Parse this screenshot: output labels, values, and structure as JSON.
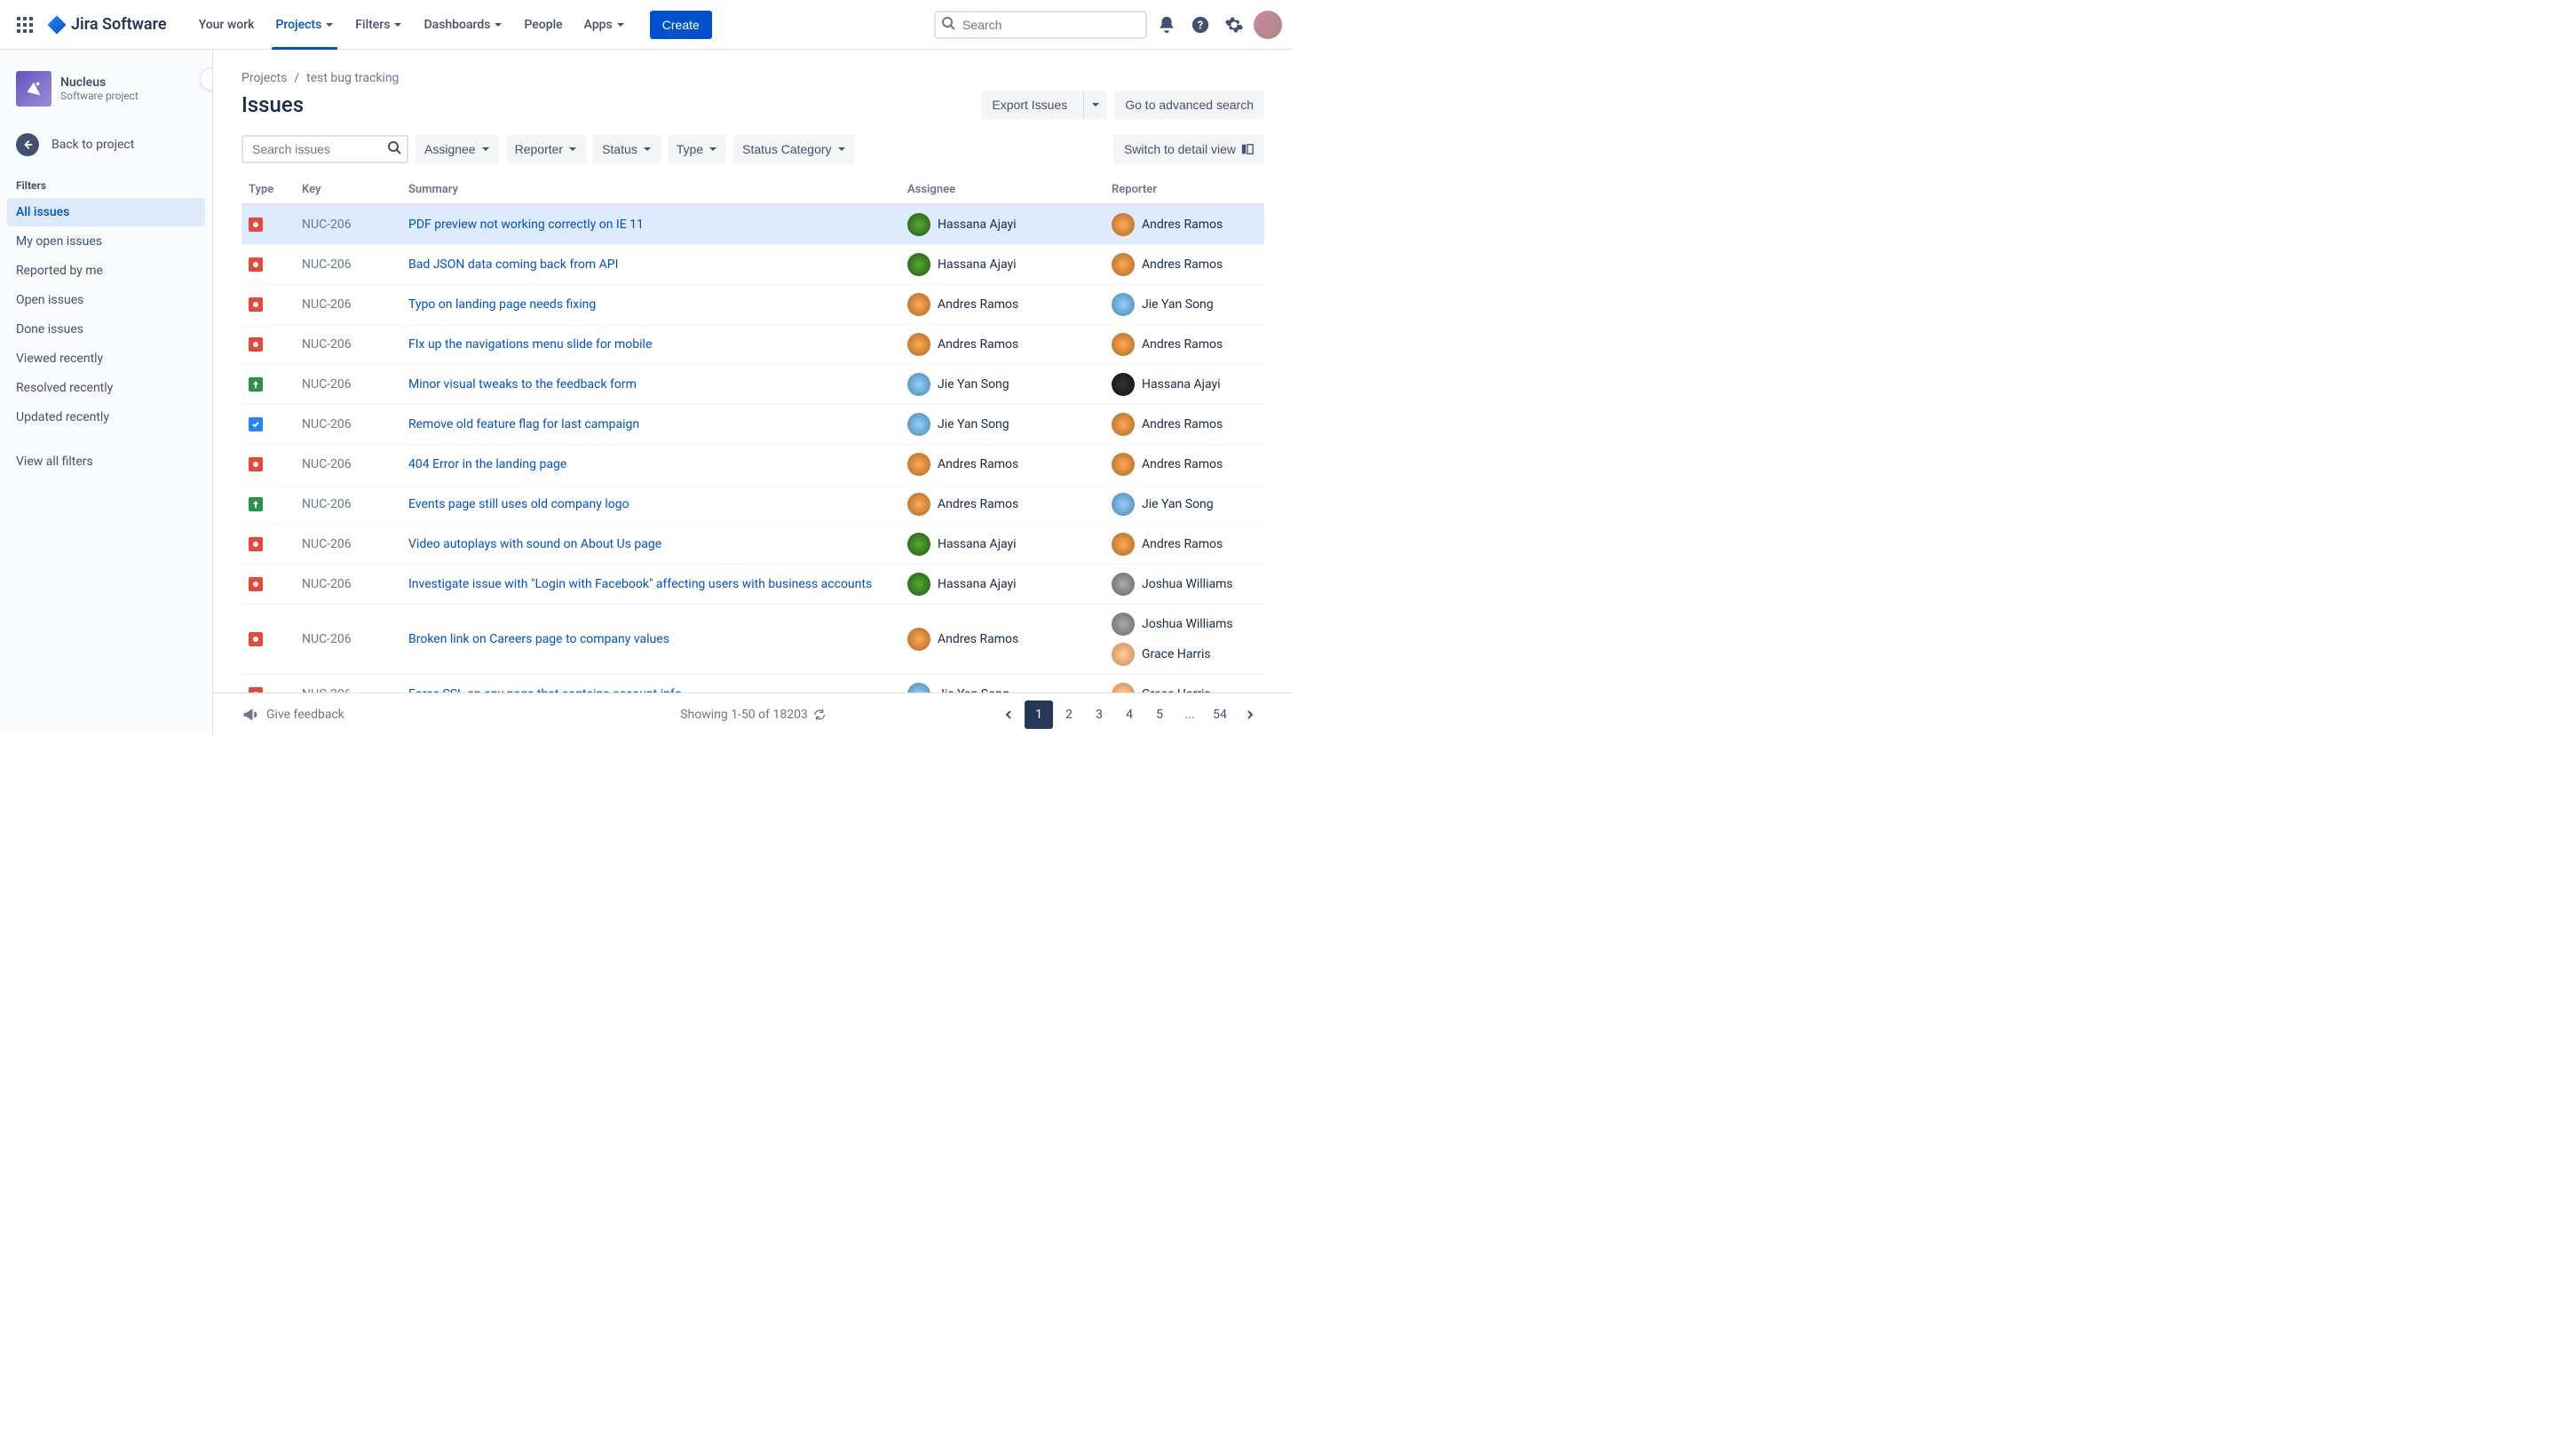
{
  "topnav": {
    "logo_text": "Jira Software",
    "items": [
      {
        "label": "Your work",
        "dropdown": false,
        "active": false
      },
      {
        "label": "Projects",
        "dropdown": true,
        "active": true
      },
      {
        "label": "Filters",
        "dropdown": true,
        "active": false
      },
      {
        "label": "Dashboards",
        "dropdown": true,
        "active": false
      },
      {
        "label": "People",
        "dropdown": false,
        "active": false
      },
      {
        "label": "Apps",
        "dropdown": true,
        "active": false
      }
    ],
    "create_label": "Create",
    "search_placeholder": "Search"
  },
  "sidebar": {
    "project_name": "Nucleus",
    "project_type": "Software project",
    "back_label": "Back to project",
    "filters_heading": "Filters",
    "filters": [
      {
        "label": "All issues",
        "active": true
      },
      {
        "label": "My open issues",
        "active": false
      },
      {
        "label": "Reported by me",
        "active": false
      },
      {
        "label": "Open issues",
        "active": false
      },
      {
        "label": "Done issues",
        "active": false
      },
      {
        "label": "Viewed recently",
        "active": false
      },
      {
        "label": "Resolved recently",
        "active": false
      },
      {
        "label": "Updated recently",
        "active": false
      }
    ],
    "view_all": "View all filters"
  },
  "breadcrumbs": [
    "Projects",
    "test bug tracking"
  ],
  "page_title": "Issues",
  "actions": {
    "export": "Export Issues",
    "advanced": "Go to advanced search"
  },
  "filterbar": {
    "search_placeholder": "Search issues",
    "pills": [
      "Assignee",
      "Reporter",
      "Status",
      "Type",
      "Status Category"
    ],
    "switch_view": "Switch to detail view"
  },
  "columns": [
    "Type",
    "Key",
    "Summary",
    "Assignee",
    "Reporter"
  ],
  "rows": [
    {
      "type": "bug",
      "key": "NUC-206",
      "summary": "PDF preview not working correctly on IE 11",
      "assignee": {
        "name": "Hassana Ajayi",
        "av": "av1"
      },
      "reporter": {
        "name": "Andres Ramos",
        "av": "av2"
      },
      "sel": true
    },
    {
      "type": "bug",
      "key": "NUC-206",
      "summary": "Bad JSON data coming back from API",
      "assignee": {
        "name": "Hassana Ajayi",
        "av": "av1"
      },
      "reporter": {
        "name": "Andres Ramos",
        "av": "av2"
      }
    },
    {
      "type": "bug",
      "key": "NUC-206",
      "summary": "Typo on landing page needs fixing",
      "assignee": {
        "name": "Andres Ramos",
        "av": "av2"
      },
      "reporter": {
        "name": "Jie Yan Song",
        "av": "av3"
      }
    },
    {
      "type": "bug",
      "key": "NUC-206",
      "summary": "FIx up the navigations menu slide for mobile",
      "assignee": {
        "name": "Andres Ramos",
        "av": "av2"
      },
      "reporter": {
        "name": "Andres Ramos",
        "av": "av2"
      }
    },
    {
      "type": "improve",
      "key": "NUC-206",
      "summary": "Minor visual tweaks to the feedback form",
      "assignee": {
        "name": "Jie Yan Song",
        "av": "av3"
      },
      "reporter": {
        "name": "Hassana Ajayi",
        "av": "av4"
      }
    },
    {
      "type": "task",
      "key": "NUC-206",
      "summary": "Remove old feature flag for last campaign",
      "assignee": {
        "name": "Jie Yan Song",
        "av": "av3"
      },
      "reporter": {
        "name": "Andres Ramos",
        "av": "av2"
      }
    },
    {
      "type": "bug",
      "key": "NUC-206",
      "summary": "404 Error in the landing page",
      "assignee": {
        "name": "Andres Ramos",
        "av": "av2"
      },
      "reporter": {
        "name": "Andres Ramos",
        "av": "av2"
      }
    },
    {
      "type": "improve",
      "key": "NUC-206",
      "summary": "Events page still uses old company logo",
      "assignee": {
        "name": "Andres Ramos",
        "av": "av2"
      },
      "reporter": {
        "name": "Jie Yan Song",
        "av": "av3"
      }
    },
    {
      "type": "bug",
      "key": "NUC-206",
      "summary": "Video autoplays with sound on About Us page",
      "assignee": {
        "name": "Hassana Ajayi",
        "av": "av1"
      },
      "reporter": {
        "name": "Andres Ramos",
        "av": "av2"
      }
    },
    {
      "type": "bug",
      "key": "NUC-206",
      "summary": "Investigate issue with \"Login with Facebook\" affecting users with business accounts",
      "assignee": {
        "name": "Hassana Ajayi",
        "av": "av1"
      },
      "reporter": {
        "name": "Joshua Williams",
        "av": "av6"
      }
    },
    {
      "type": "bug",
      "key": "NUC-206",
      "summary": "Broken link on Careers page to company values",
      "assignee": {
        "name": "Andres Ramos",
        "av": "av2"
      },
      "reporter": {
        "name": "Joshua Williams",
        "av": "av6"
      },
      "reporter2": {
        "name": "Grace Harris",
        "av": "av5"
      }
    },
    {
      "type": "bug",
      "key": "NUC-206",
      "summary": "Force SSL on any page that contains account info",
      "assignee": {
        "name": "Jie Yan Song",
        "av": "av3"
      },
      "reporter": {
        "name": "Grace Harris",
        "av": "av5"
      }
    }
  ],
  "footer": {
    "feedback": "Give feedback",
    "showing": "Showing 1-50 of 18203",
    "pages": [
      "1",
      "2",
      "3",
      "4",
      "5",
      "...",
      "54"
    ]
  }
}
